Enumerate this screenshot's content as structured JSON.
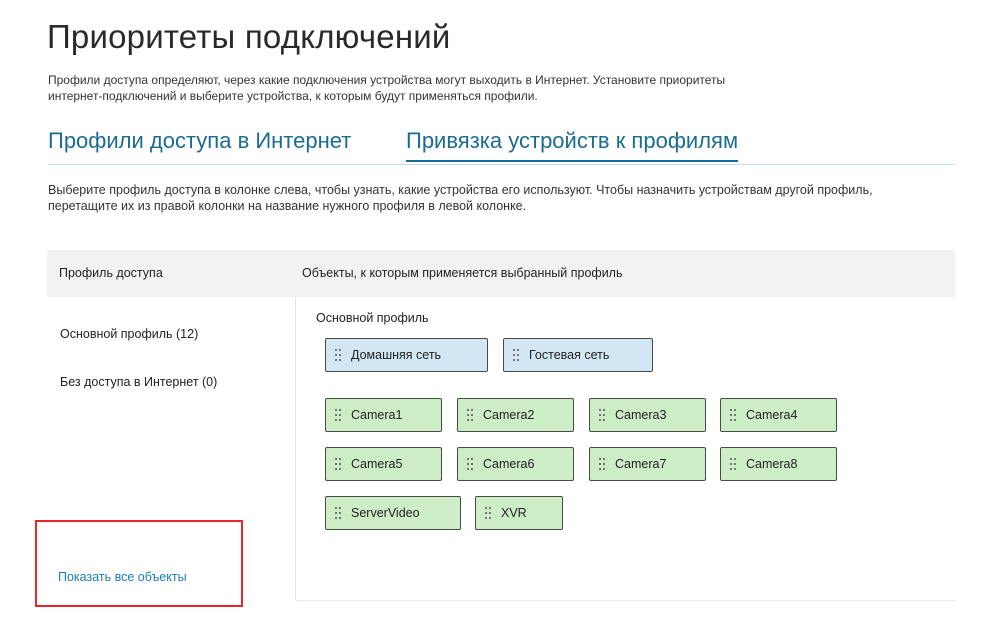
{
  "page": {
    "title": "Приоритеты подключений",
    "description_line1": "Профили доступа определяют, через какие подключения устройства могут выходить в Интернет. Установите приоритеты",
    "description_line2": "интернет-подключений и выберите устройства, к которым будут применяться профили."
  },
  "tabs": [
    {
      "label": "Профили доступа в Интернет",
      "active": false
    },
    {
      "label": "Привязка устройств к профилям",
      "active": true
    }
  ],
  "instructions": {
    "line1": "Выберите профиль доступа в колонке слева, чтобы узнать, какие устройства его используют. Чтобы назначить устройствам другой профиль,",
    "line2": "перетащите их из правой колонки на название нужного профиля в левой колонке."
  },
  "table": {
    "left_header": "Профиль доступа",
    "right_header": "Объекты, к которым применяется выбранный профиль"
  },
  "profiles": [
    {
      "label": "Основной профиль (12)"
    },
    {
      "label": "Без доступа в Интернет (0)"
    }
  ],
  "show_all_link": "Показать все объекты",
  "selected_profile": {
    "title": "Основной профиль",
    "networks": [
      {
        "label": "Домашняя сеть"
      },
      {
        "label": "Гостевая сеть"
      }
    ],
    "devices": [
      {
        "label": "Camera1"
      },
      {
        "label": "Camera2"
      },
      {
        "label": "Camera3"
      },
      {
        "label": "Camera4"
      },
      {
        "label": "Camera5"
      },
      {
        "label": "Camera6"
      },
      {
        "label": "Camera7"
      },
      {
        "label": "Camera8"
      },
      {
        "label": "ServerVideo"
      },
      {
        "label": "XVR"
      }
    ]
  },
  "colors": {
    "accent": "#1b6c93",
    "link": "#1a7fb5",
    "network_chip": "#d3e6f4",
    "device_chip": "#ccedc5",
    "highlight": "#e8262b"
  },
  "icons": {
    "chip_handle": "drag-handle-icon"
  }
}
